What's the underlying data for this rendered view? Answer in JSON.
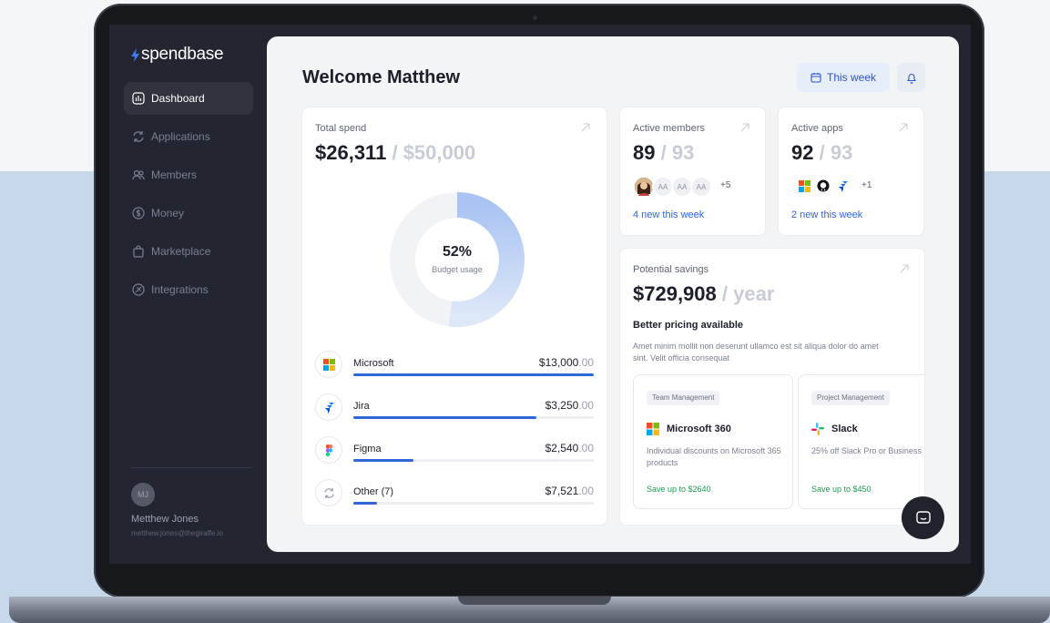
{
  "brand": {
    "name": "spendbase"
  },
  "nav": {
    "items": [
      {
        "label": "Dashboard",
        "icon": "chart-icon",
        "active": true
      },
      {
        "label": "Applications",
        "icon": "refresh-icon"
      },
      {
        "label": "Members",
        "icon": "members-icon"
      },
      {
        "label": "Money",
        "icon": "dollar-icon"
      },
      {
        "label": "Marketplace",
        "icon": "bag-icon"
      },
      {
        "label": "Integrations",
        "icon": "integrations-icon"
      }
    ]
  },
  "user": {
    "initials": "MJ",
    "name": "Metthew Jones",
    "email": "metthew.jones@thegiraffe.io"
  },
  "header": {
    "welcome": "Welcome Matthew",
    "period_label": "This week"
  },
  "total_spend": {
    "label": "Total spend",
    "amount": "$26,311",
    "budget": "/ $50,000",
    "usage_pct": "52%",
    "usage_value": 0.52,
    "usage_label": "Budget usage",
    "vendors": [
      {
        "name": "Microsoft",
        "amount": "$13,000",
        "cents": ".00",
        "fill": 1.0
      },
      {
        "name": "Jira",
        "amount": "$3,250",
        "cents": ".00",
        "fill": 0.76
      },
      {
        "name": "Figma",
        "amount": "$2,540",
        "cents": ".00",
        "fill": 0.25
      },
      {
        "name": "Other (7)",
        "amount": "$7,521",
        "cents": ".00",
        "fill": 0.1
      }
    ]
  },
  "members": {
    "label": "Active members",
    "count": "89",
    "total": "/ 93",
    "avatars": [
      "AA",
      "AA",
      "AA"
    ],
    "more": "+5",
    "link": "4 new this week"
  },
  "apps": {
    "label": "Active apps",
    "count": "92",
    "total": "/ 93",
    "more": "+1",
    "link": "2 new this week"
  },
  "savings": {
    "label": "Potential savings",
    "amount": "$729,908",
    "period": "/ year",
    "heading": "Better pricing available",
    "description": "Amet minim mollit non deserunt ullamco est sit aliqua dolor do amet sint. Velit officia consequat",
    "offers": [
      {
        "tag": "Team Management",
        "title": "Microsoft 360",
        "desc": "Individual discounts on Microsoft 365 products",
        "save": "Save up to $2640"
      },
      {
        "tag": "Project Management",
        "title": "Slack",
        "desc": "25% off Slack Pro or Business",
        "save": "Save up to $450"
      }
    ]
  },
  "colors": {
    "accent": "#2f66d6",
    "donut_fill": "#a9c3f2",
    "donut_track": "#f1f3f7",
    "save": "#1f9a4d"
  }
}
